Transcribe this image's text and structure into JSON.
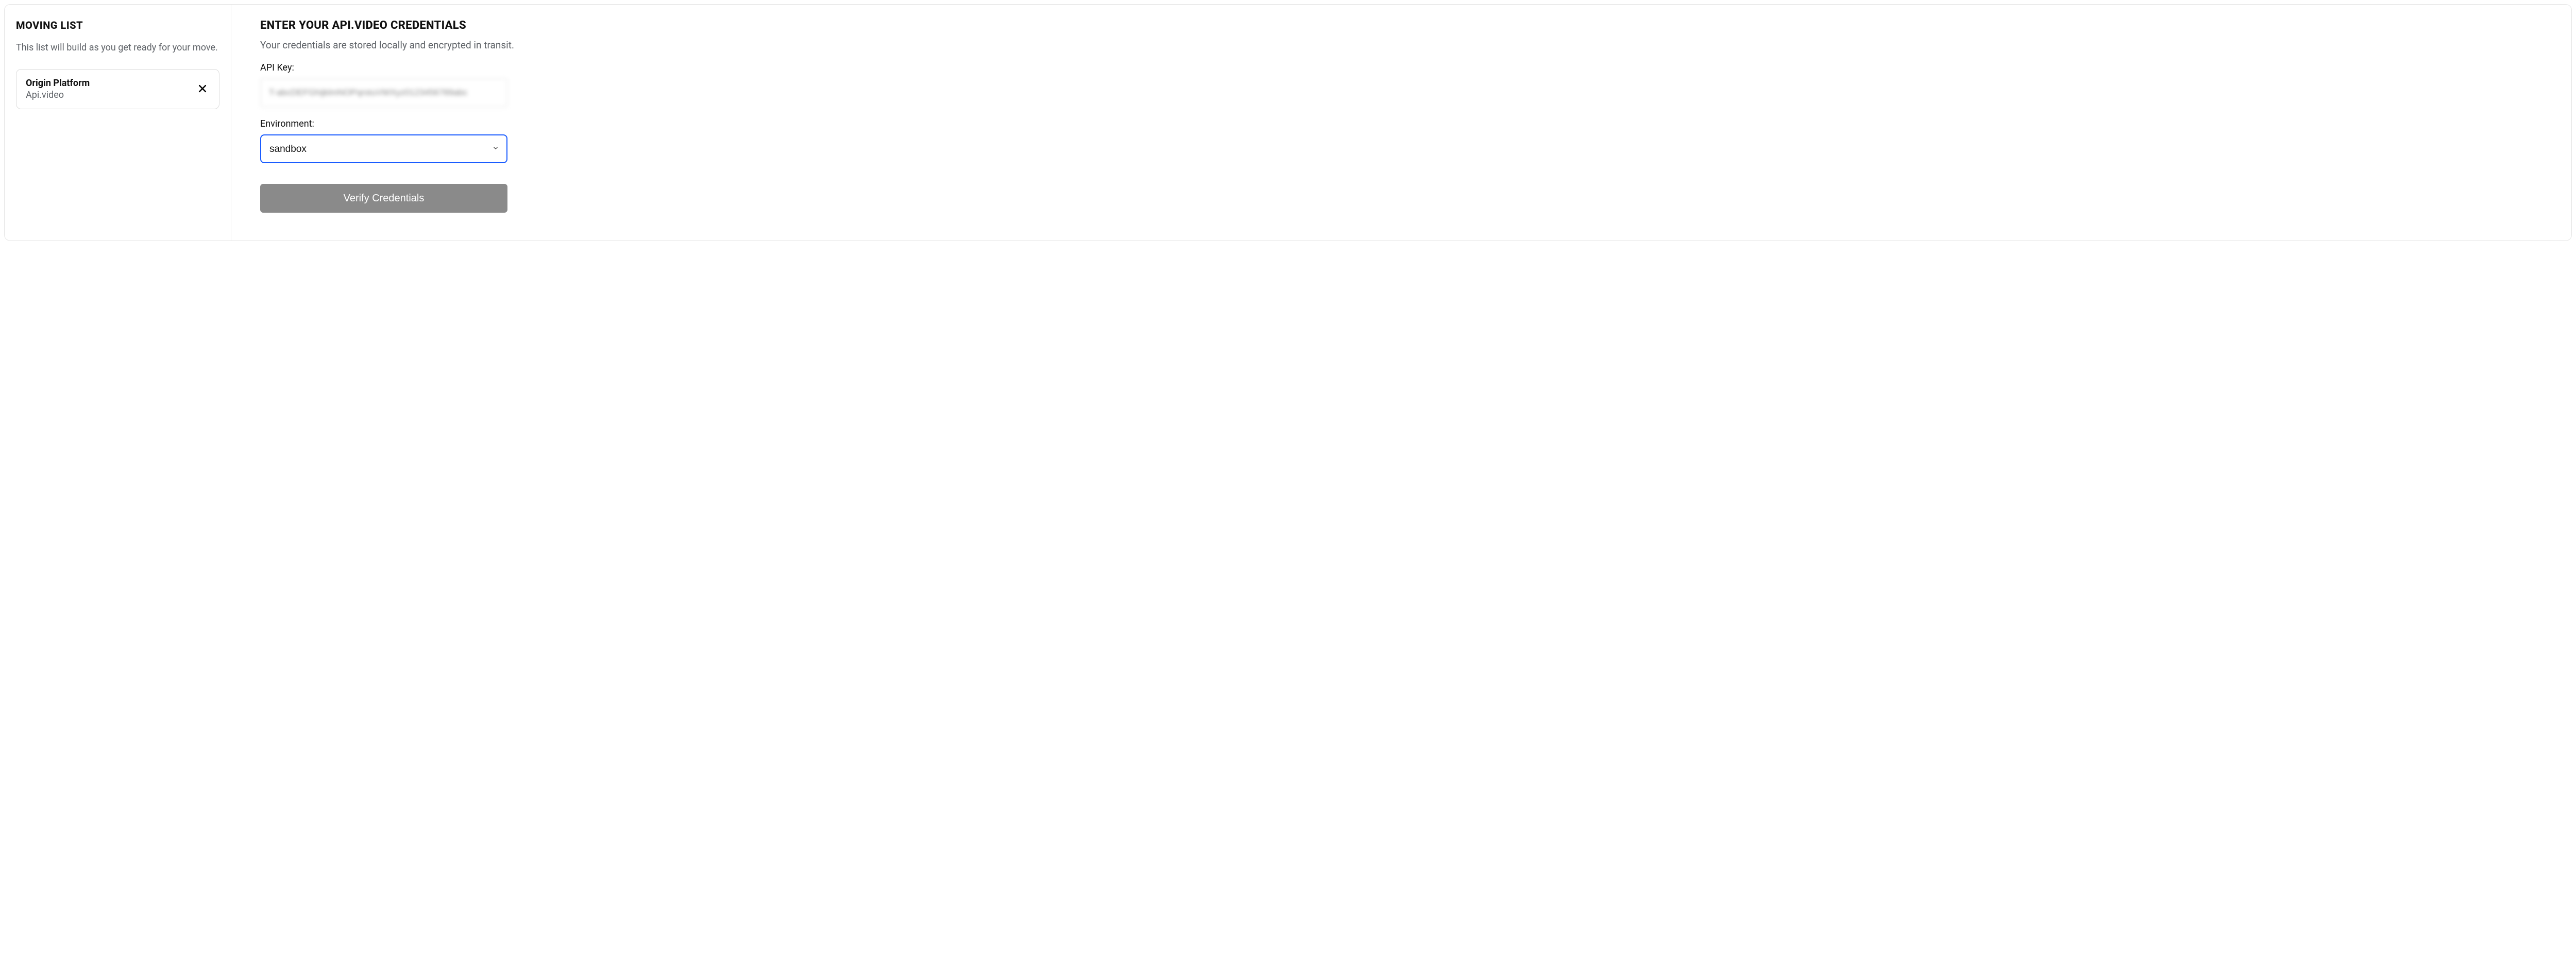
{
  "sidebar": {
    "title": "MOVING LIST",
    "description": "This list will build as you get ready for your move.",
    "items": [
      {
        "label": "Origin Platform",
        "value": "Api.video"
      }
    ]
  },
  "main": {
    "title": "ENTER YOUR API.VIDEO CREDENTIALS",
    "description": "Your credentials are stored locally and encrypted in transit.",
    "api_key_label": "API Key:",
    "api_key_value": "T-abcDEFGhijklmNOPqrstuVWXyz0123456789abc",
    "environment_label": "Environment:",
    "environment_value": "sandbox",
    "verify_button": "Verify Credentials"
  }
}
